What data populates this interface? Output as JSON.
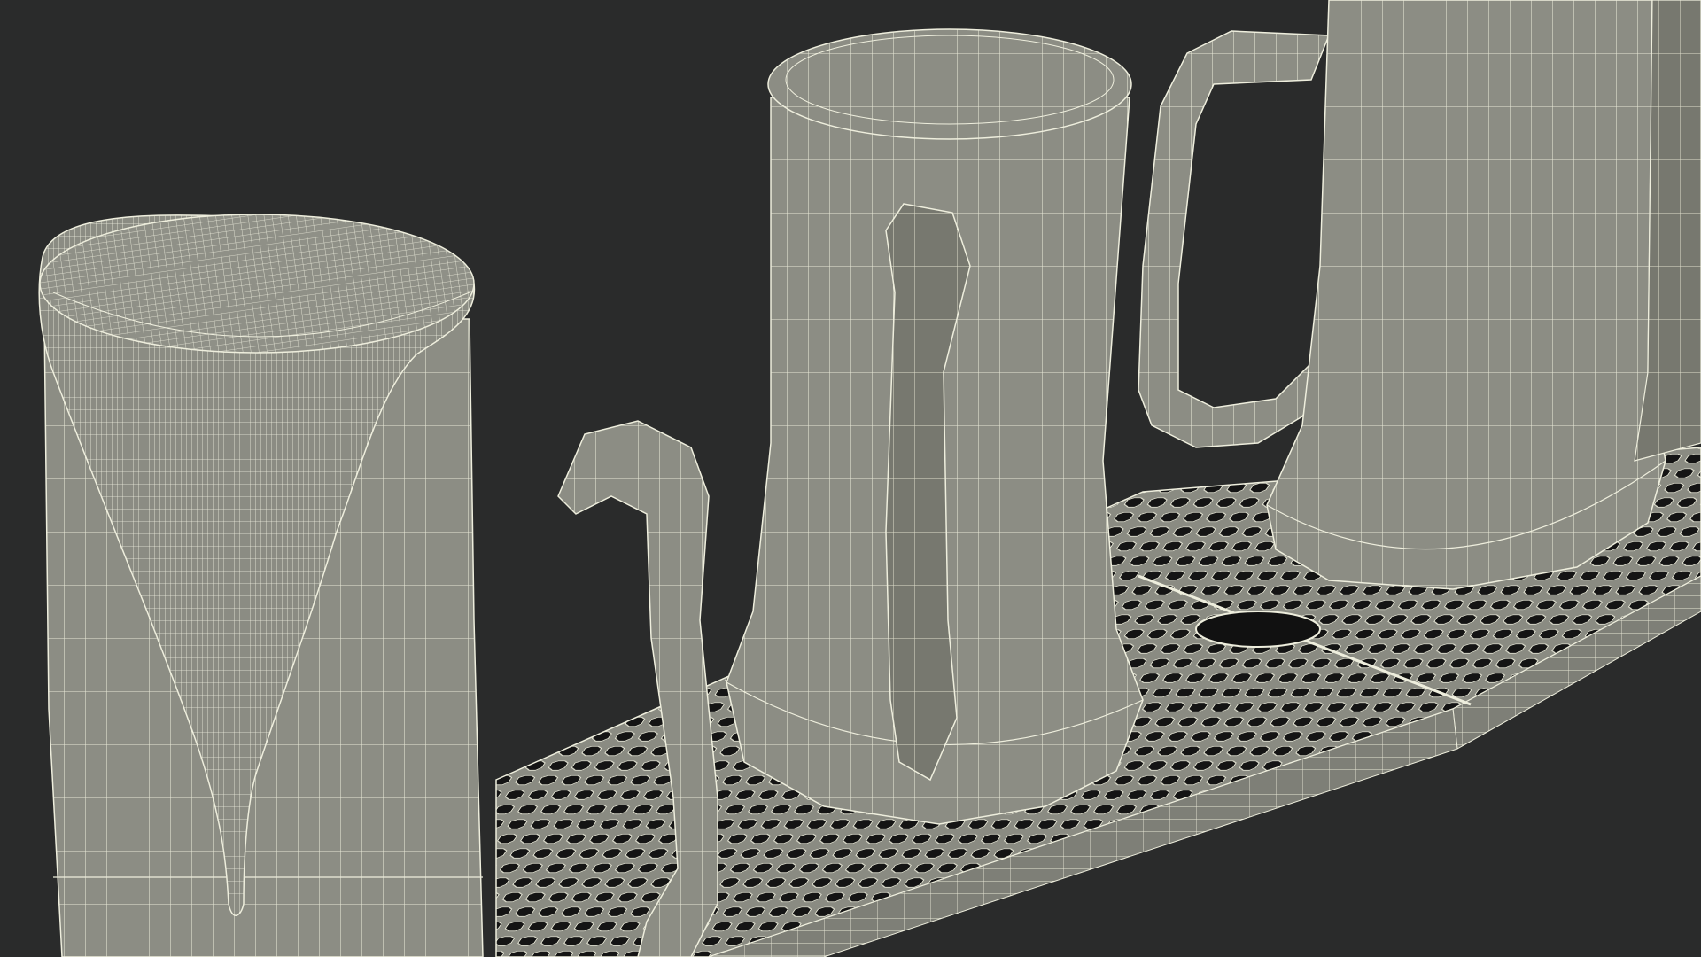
{
  "scene": {
    "background_color": "#2a2b2b",
    "surface_color": "#8e8f86",
    "surface_shadow_color": "#5d5e58",
    "wire_color": "#eeeedd",
    "hole_color": "#151515",
    "objects": [
      {
        "name": "beer-mug-with-foam",
        "kind": "mug"
      },
      {
        "name": "beer-mug-center",
        "kind": "mug"
      },
      {
        "name": "beer-mug-right",
        "kind": "mug"
      },
      {
        "name": "drip-tray",
        "kind": "bar-mat"
      }
    ]
  }
}
